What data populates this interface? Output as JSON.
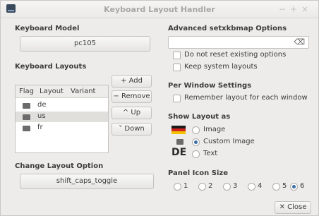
{
  "window": {
    "title": "Keyboard Layout Handler"
  },
  "keyboard_model": {
    "label": "Keyboard Model",
    "value": "pc105"
  },
  "keyboard_layouts": {
    "label": "Keyboard Layouts",
    "columns": [
      "Flag",
      "Layout",
      "Variant"
    ],
    "rows": [
      {
        "layout": "de",
        "variant": ""
      },
      {
        "layout": "us",
        "variant": "",
        "selected": true
      },
      {
        "layout": "fr",
        "variant": ""
      }
    ],
    "buttons": {
      "add": "+ Add",
      "remove": "− Remove",
      "up": "^ Up",
      "down": "˅ Down"
    }
  },
  "change_layout_option": {
    "label": "Change Layout Option",
    "value": "shift_caps_toggle"
  },
  "advanced": {
    "label": "Advanced setxkbmap Options",
    "input_value": "",
    "no_reset_label": "Do not reset existing options",
    "keep_system_label": "Keep system layouts"
  },
  "per_window": {
    "label": "Per Window Settings",
    "remember_label": "Remember layout for each window"
  },
  "show_layout": {
    "label": "Show Layout as",
    "options": [
      "Image",
      "Custom Image",
      "Text"
    ],
    "selected": "Custom Image",
    "text_preview": "DE"
  },
  "panel_icon_size": {
    "label": "Panel Icon Size",
    "options": [
      "1",
      "2",
      "3",
      "4",
      "5",
      "6"
    ],
    "selected": "6"
  },
  "close_label": "✕ Close",
  "colors": {
    "accent": "#3b6ea8",
    "window_bg": "#edecea",
    "selected_row": "#e0dfdc"
  }
}
